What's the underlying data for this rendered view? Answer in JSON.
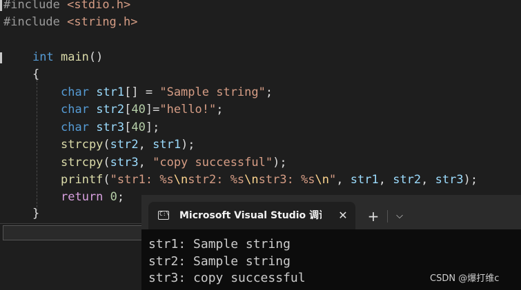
{
  "editor": {
    "lines": {
      "l1": {
        "directive": "#include",
        "header": "<stdio.h>"
      },
      "l2": {
        "directive": "#include",
        "header": "<string.h>"
      },
      "l4": {
        "type": "int",
        "name": "main",
        "parens": "()"
      },
      "l5": {
        "brace": "{"
      },
      "l6": {
        "type": "char",
        "var": "str1",
        "rest": "[] = ",
        "str": "\"Sample string\"",
        "end": ";"
      },
      "l7": {
        "type": "char",
        "var": "str2",
        "b1": "[",
        "num": "40",
        "b2": "]=",
        "str": "\"hello!\"",
        "end": ";"
      },
      "l8": {
        "type": "char",
        "var": "str3",
        "b1": "[",
        "num": "40",
        "b2": "];"
      },
      "l9": {
        "fn": "strcpy",
        "open": "(",
        "a1": "str2",
        "sep": ", ",
        "a2": "str1",
        "close": ");"
      },
      "l10": {
        "fn": "strcpy",
        "open": "(",
        "a1": "str3",
        "sep": ", ",
        "str": "\"copy successful\"",
        "close": ");"
      },
      "l11": {
        "fn": "printf",
        "open": "(",
        "s1": "\"str1: %s",
        "e1": "\\n",
        "s2": "str2: %s",
        "e2": "\\n",
        "s3": "str3: %s",
        "e3": "\\n",
        "s4": "\"",
        "sep1": ", ",
        "a1": "str1",
        "sep2": ", ",
        "a2": "str2",
        "sep3": ", ",
        "a3": "str3",
        "close": ");"
      },
      "l12": {
        "kw": "return",
        "num": "0",
        "end": ";"
      },
      "l13": {
        "brace": "}"
      }
    }
  },
  "terminal": {
    "tab_title": "Microsoft Visual Studio 调试控制台",
    "close_glyph": "✕",
    "new_tab_glyph": "+",
    "dropdown_glyph": "⌵",
    "output": [
      "str1: Sample string",
      "str2: Sample string",
      "str3: copy successful"
    ]
  },
  "watermark": "CSDN @爆打维c"
}
